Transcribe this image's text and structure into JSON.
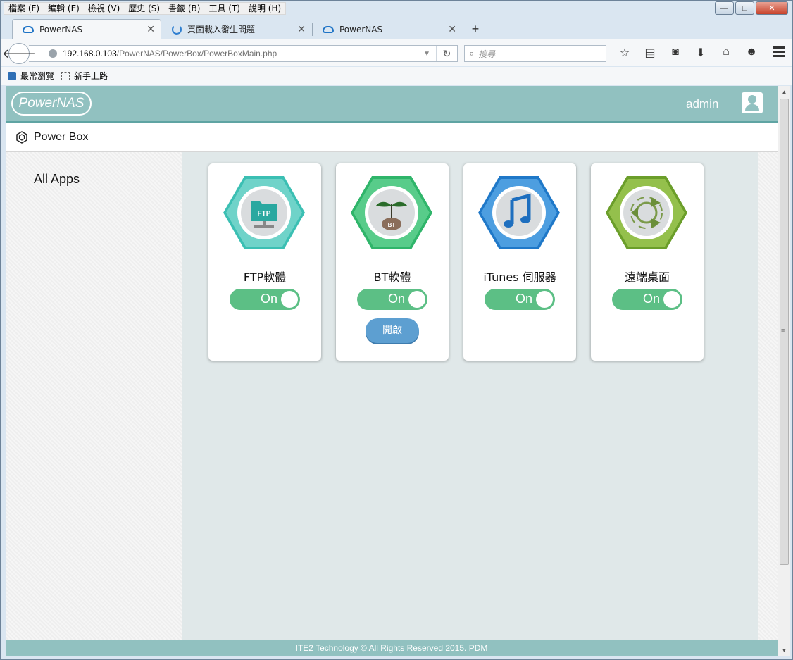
{
  "browser": {
    "menu": [
      "檔案 (F)",
      "編輯 (E)",
      "檢視 (V)",
      "歷史 (S)",
      "書籤 (B)",
      "工具 (T)",
      "說明 (H)"
    ],
    "tabs": [
      {
        "title": "PowerNAS",
        "icon": "cloud-icon"
      },
      {
        "title": "頁面載入發生問題",
        "icon": "loading-icon"
      },
      {
        "title": "PowerNAS",
        "icon": "cloud-icon"
      }
    ],
    "url_host": "192.168.0.103",
    "url_path": "/PowerNAS/PowerBox/PowerBoxMain.php",
    "search_placeholder": "搜尋",
    "bookmarks": [
      "最常瀏覽",
      "新手上路"
    ]
  },
  "app": {
    "logo_text": "PowerNAS",
    "user": "admin",
    "breadcrumb": "Power Box",
    "sidebar_title": "All Apps",
    "footer": "ITE2 Technology © All Rights Reserved 2015. PDM",
    "colors": {
      "header": "#91c1c0",
      "toggle_on": "#5cbf85",
      "open_button": "#5d9fd1"
    }
  },
  "apps": [
    {
      "name": "FTP軟體",
      "toggle": "On",
      "icon": "ftp-icon"
    },
    {
      "name": "BT軟體",
      "toggle": "On",
      "icon": "bt-sprout-icon",
      "open_label": "開啟"
    },
    {
      "name": "iTunes 伺服器",
      "toggle": "On",
      "icon": "music-note-icon"
    },
    {
      "name": "遠端桌面",
      "toggle": "On",
      "icon": "remote-desktop-icon"
    }
  ]
}
